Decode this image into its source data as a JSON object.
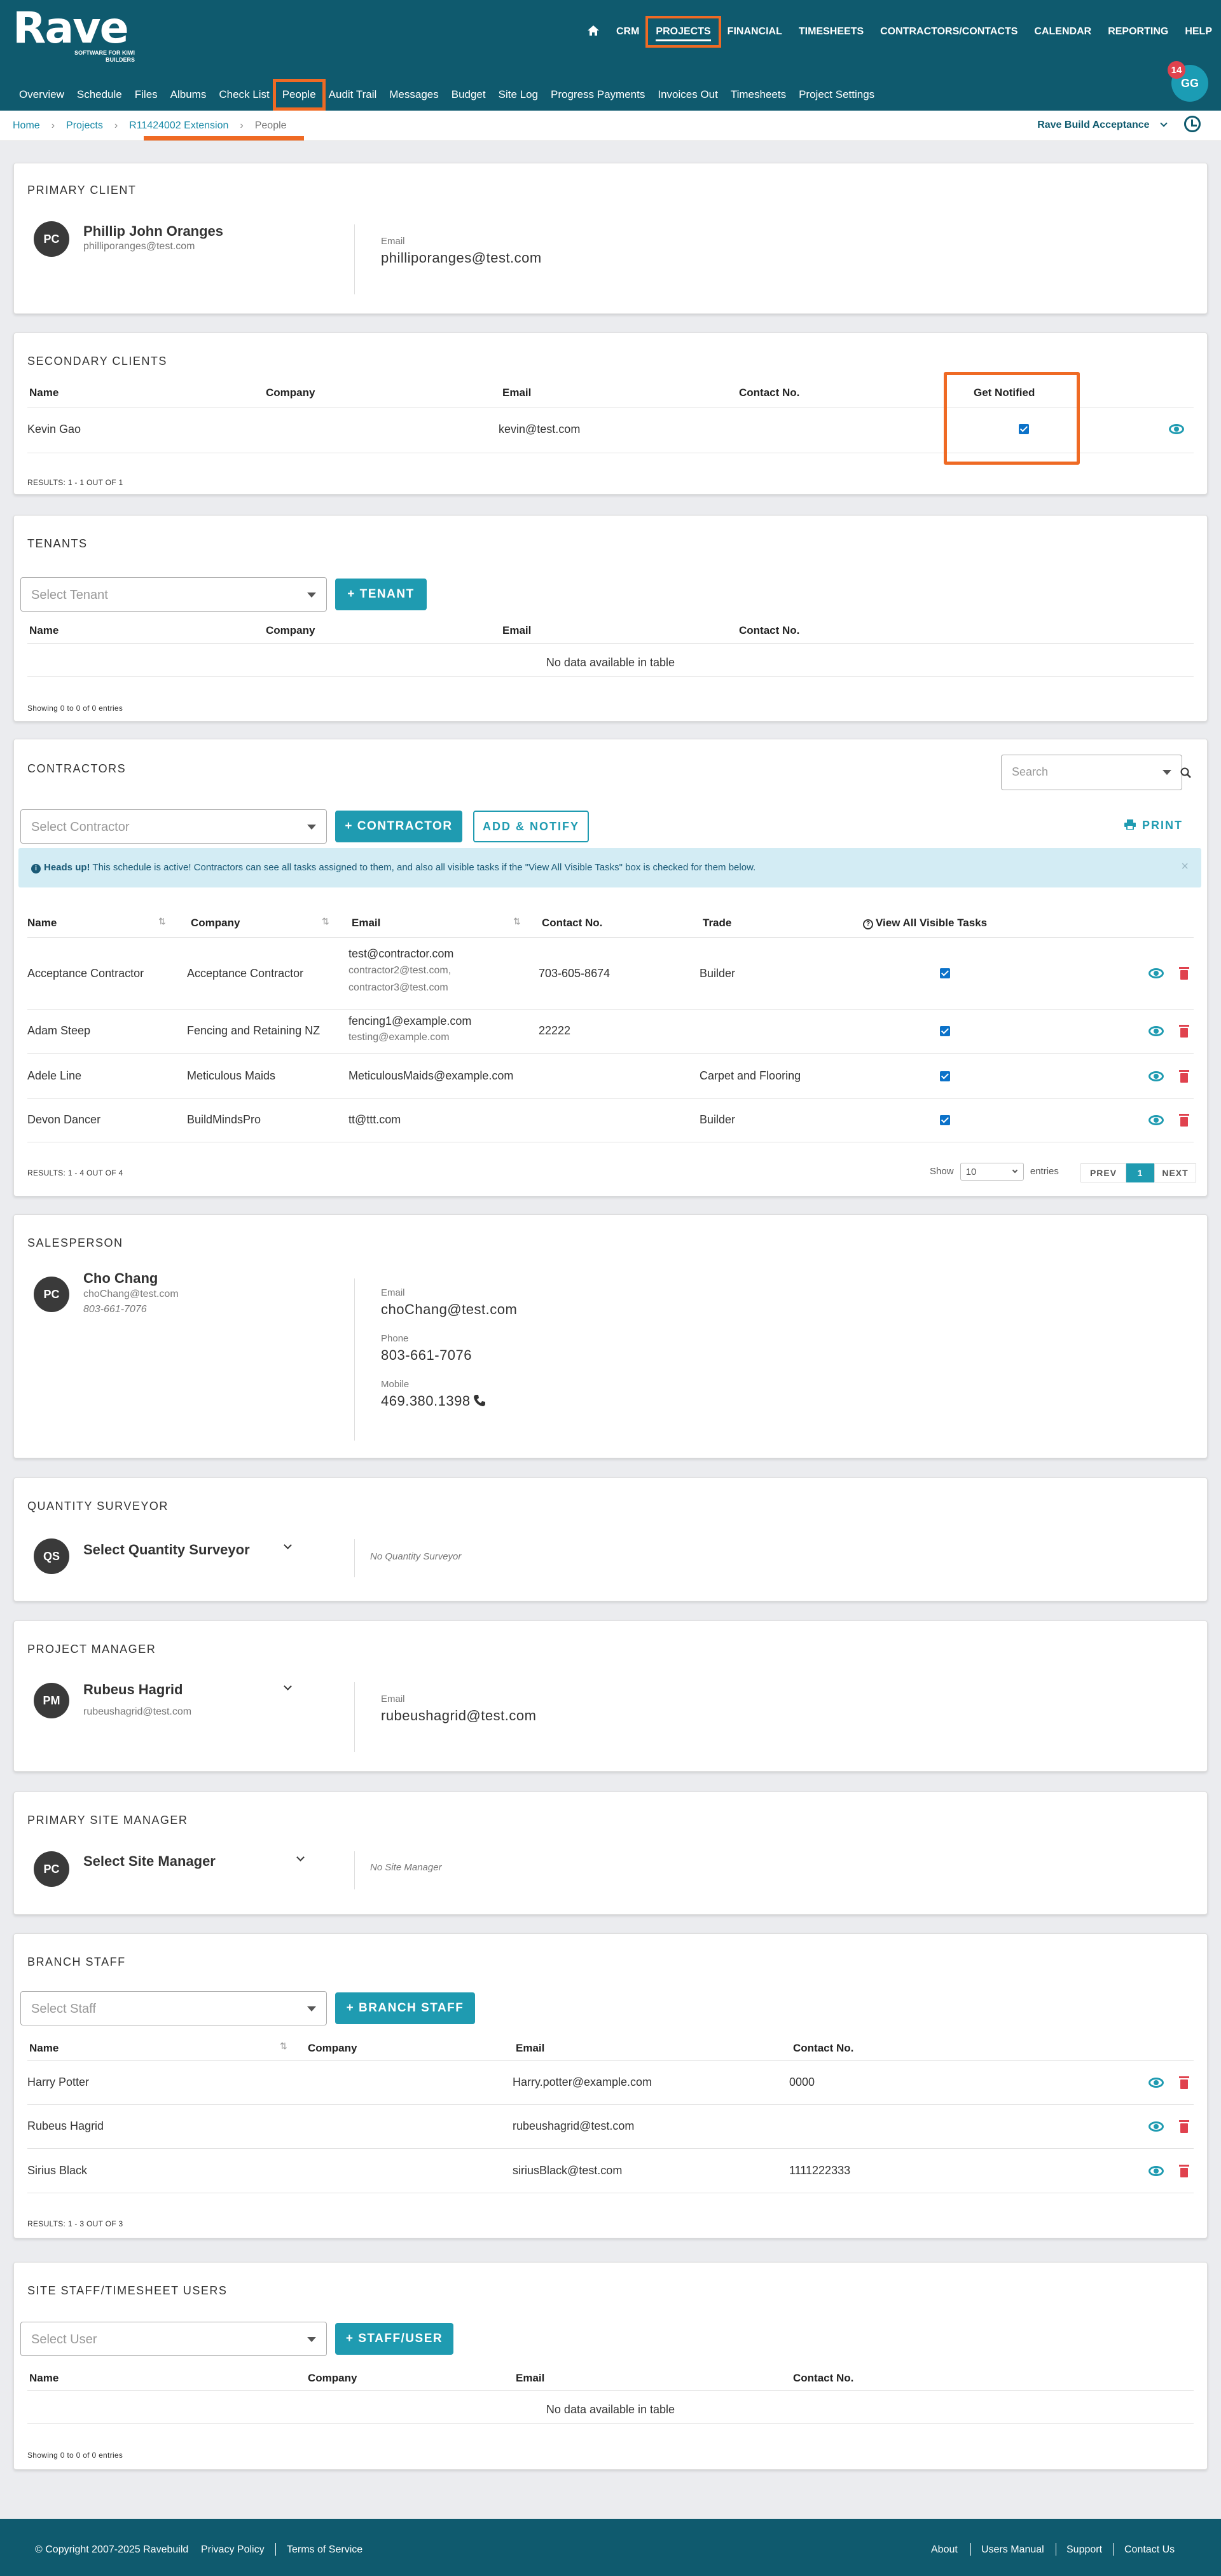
{
  "brand": {
    "logo": "Rave",
    "tagline": "SOFTWARE FOR KIWI BUILDERS"
  },
  "topnav": [
    "CRM",
    "PROJECTS",
    "FINANCIAL",
    "TIMESHEETS",
    "CONTRACTORS/CONTACTS",
    "CALENDAR",
    "REPORTING",
    "HELP"
  ],
  "subnav": [
    "Overview",
    "Schedule",
    "Files",
    "Albums",
    "Check List",
    "People",
    "Audit Trail",
    "Messages",
    "Budget",
    "Site Log",
    "Progress Payments",
    "Invoices Out",
    "Timesheets",
    "Project Settings"
  ],
  "user": {
    "initials": "GG",
    "notifications": "14"
  },
  "breadcrumb": {
    "home": "Home",
    "projects": "Projects",
    "project": "R11424002 Extension",
    "current": "People",
    "sep": "›"
  },
  "project_selector": "Rave Build Acceptance",
  "primary_client": {
    "title": "PRIMARY CLIENT",
    "initials": "PC",
    "name": "Phillip John Oranges",
    "email_small": "philliporanges@test.com",
    "email_label": "Email",
    "email": "philliporanges@test.com"
  },
  "secondary_clients": {
    "title": "SECONDARY CLIENTS",
    "headers": {
      "name": "Name",
      "company": "Company",
      "email": "Email",
      "contact": "Contact No.",
      "notify": "Get Notified"
    },
    "rows": [
      {
        "name": "Kevin Gao",
        "company": "",
        "email": "kevin@test.com",
        "contact": ""
      }
    ],
    "results": "RESULTS: 1 - 1 OUT OF 1"
  },
  "tenants": {
    "title": "TENANTS",
    "select_placeholder": "Select Tenant",
    "add_button": "+ TENANT",
    "headers": {
      "name": "Name",
      "company": "Company",
      "email": "Email",
      "contact": "Contact No."
    },
    "empty": "No data available in table",
    "results": "Showing 0 to 0 of 0 entries"
  },
  "contractors": {
    "title": "CONTRACTORS",
    "search_placeholder": "Search",
    "select_placeholder": "Select Contractor",
    "add_button": "+ CONTRACTOR",
    "notify_button": "ADD & NOTIFY",
    "print_button": "PRINT",
    "alert_strong": "Heads up!",
    "alert_text": "This schedule is active! Contractors can see all tasks assigned to them, and also all visible tasks if the \"View All Visible Tasks\" box is checked for them below.",
    "headers": {
      "name": "Name",
      "company": "Company",
      "email": "Email",
      "contact": "Contact No.",
      "trade": "Trade",
      "visible": "View All Visible Tasks"
    },
    "rows": [
      {
        "name": "Acceptance Contractor",
        "company": "Acceptance Contractor",
        "email": "test@contractor.com",
        "email2": "contractor2@test.com,",
        "email3": "contractor3@test.com",
        "contact": "703-605-8674",
        "trade": "Builder"
      },
      {
        "name": "Adam Steep",
        "company": "Fencing and Retaining NZ",
        "email": "fencing1@example.com",
        "email2": "testing@example.com",
        "contact": "22222",
        "trade": ""
      },
      {
        "name": "Adele Line",
        "company": "Meticulous Maids",
        "email": "MeticulousMaids@example.com",
        "contact": "",
        "trade": "Carpet and Flooring"
      },
      {
        "name": "Devon Dancer",
        "company": "BuildMindsPro",
        "email": "tt@ttt.com",
        "contact": "",
        "trade": "Builder"
      }
    ],
    "results": "RESULTS: 1 - 4 OUT OF 4",
    "show_label": "Show",
    "entries_value": "10",
    "entries_label": "entries",
    "prev": "PREV",
    "page": "1",
    "next": "NEXT"
  },
  "salesperson": {
    "title": "SALESPERSON",
    "initials": "PC",
    "name": "Cho Chang",
    "email_small": "choChang@test.com",
    "phone_small": "803-661-7076",
    "email_label": "Email",
    "email": "choChang@test.com",
    "phone_label": "Phone",
    "phone": "803-661-7076",
    "mobile_label": "Mobile",
    "mobile": "469.380.1398"
  },
  "quantity_surveyor": {
    "title": "QUANTITY SURVEYOR",
    "initials": "QS",
    "select": "Select Quantity Surveyor",
    "note": "No Quantity Surveyor"
  },
  "project_manager": {
    "title": "PROJECT MANAGER",
    "initials": "PM",
    "name": "Rubeus Hagrid",
    "email_small": "rubeushagrid@test.com",
    "email_label": "Email",
    "email": "rubeushagrid@test.com"
  },
  "site_manager": {
    "title": "PRIMARY SITE MANAGER",
    "initials": "PC",
    "select": "Select Site Manager",
    "note": "No Site Manager"
  },
  "branch_staff": {
    "title": "BRANCH STAFF",
    "select_placeholder": "Select Staff",
    "add_button": "+ BRANCH STAFF",
    "headers": {
      "name": "Name",
      "company": "Company",
      "email": "Email",
      "contact": "Contact No."
    },
    "rows": [
      {
        "name": "Harry Potter",
        "company": "",
        "email": "Harry.potter@example.com",
        "contact": "0000"
      },
      {
        "name": "Rubeus Hagrid",
        "company": "",
        "email": "rubeushagrid@test.com",
        "contact": ""
      },
      {
        "name": "Sirius Black",
        "company": "",
        "email": "siriusBlack@test.com",
        "contact": "1111222333"
      }
    ],
    "results": "RESULTS: 1 - 3 OUT OF 3"
  },
  "site_staff": {
    "title": "SITE STAFF/TIMESHEET USERS",
    "select_placeholder": "Select User",
    "add_button": "+ STAFF/USER",
    "headers": {
      "name": "Name",
      "company": "Company",
      "email": "Email",
      "contact": "Contact No."
    },
    "empty": "No data available in table",
    "results": "Showing 0 to 0 of 0 entries"
  },
  "footer": {
    "copyright": "© Copyright 2007-2025 Ravebuild",
    "privacy": "Privacy Policy",
    "terms": "Terms of Service",
    "about": "About",
    "manual": "Users Manual",
    "support": "Support",
    "contact": "Contact Us"
  },
  "colors": {
    "header": "#0f5a6e",
    "accent": "#1f9bb1",
    "highlight": "#ef6a24",
    "danger": "#e0424e"
  }
}
